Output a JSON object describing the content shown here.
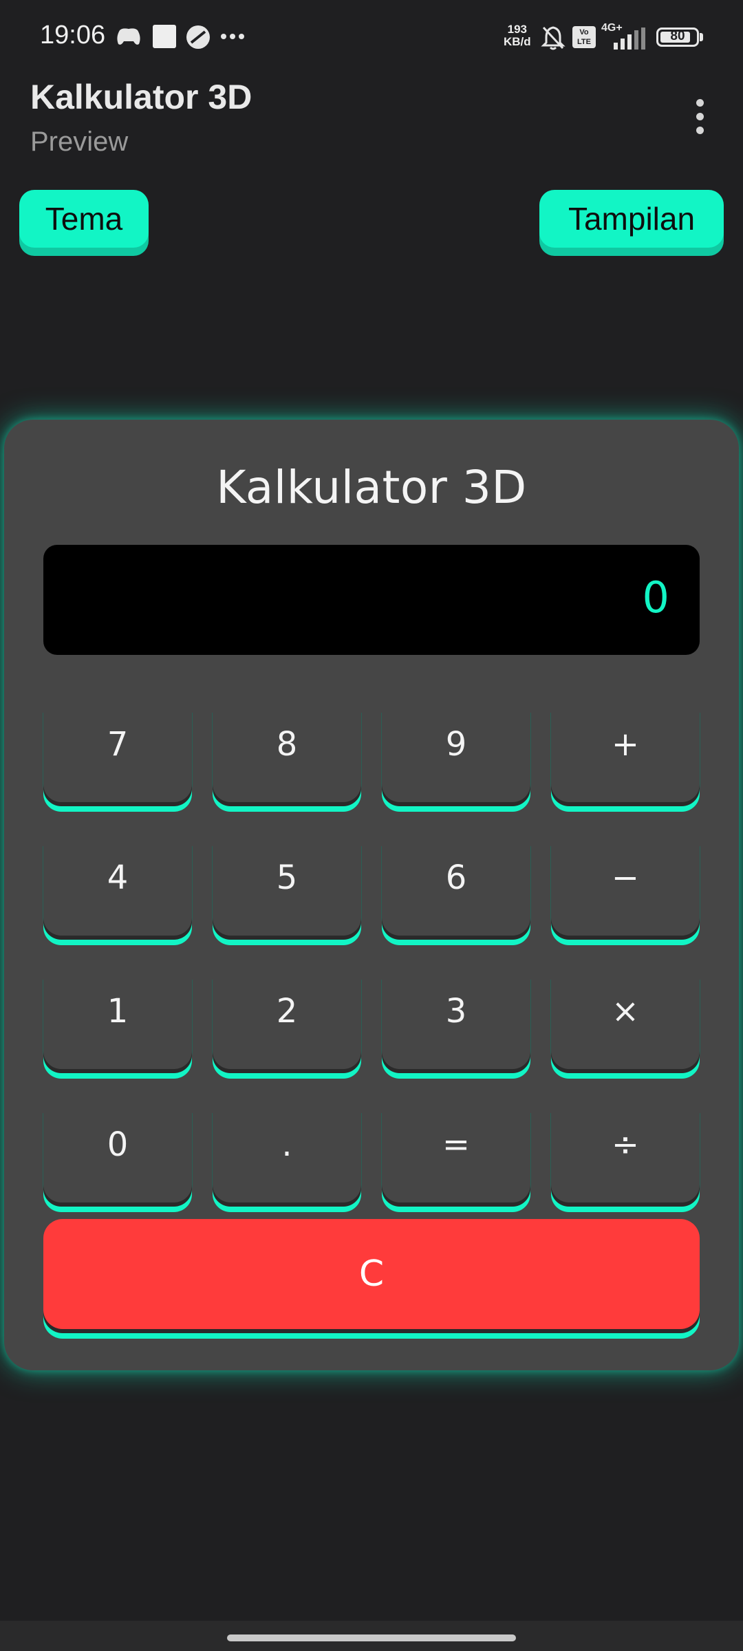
{
  "status_bar": {
    "time": "19:06",
    "speed_value": "193",
    "speed_unit": "KB/d",
    "volte_label": "Vo LTE",
    "network_label": "4G+",
    "battery": "80"
  },
  "app_bar": {
    "title": "Kalkulator 3D",
    "subtitle": "Preview"
  },
  "top_buttons": {
    "theme_label": "Tema",
    "display_label": "Tampilan"
  },
  "calculator": {
    "title": "Kalkulator 3D",
    "display_value": "0",
    "keys": [
      [
        "7",
        "8",
        "9",
        "+"
      ],
      [
        "4",
        "5",
        "6",
        "−"
      ],
      [
        "1",
        "2",
        "3",
        "×"
      ],
      [
        "0",
        ".",
        "=",
        "÷"
      ]
    ],
    "clear_label": "C"
  },
  "colors": {
    "background": "#1f1f21",
    "accent": "#12f5c5",
    "card": "#464646",
    "clear_button": "#ff3b3b"
  }
}
